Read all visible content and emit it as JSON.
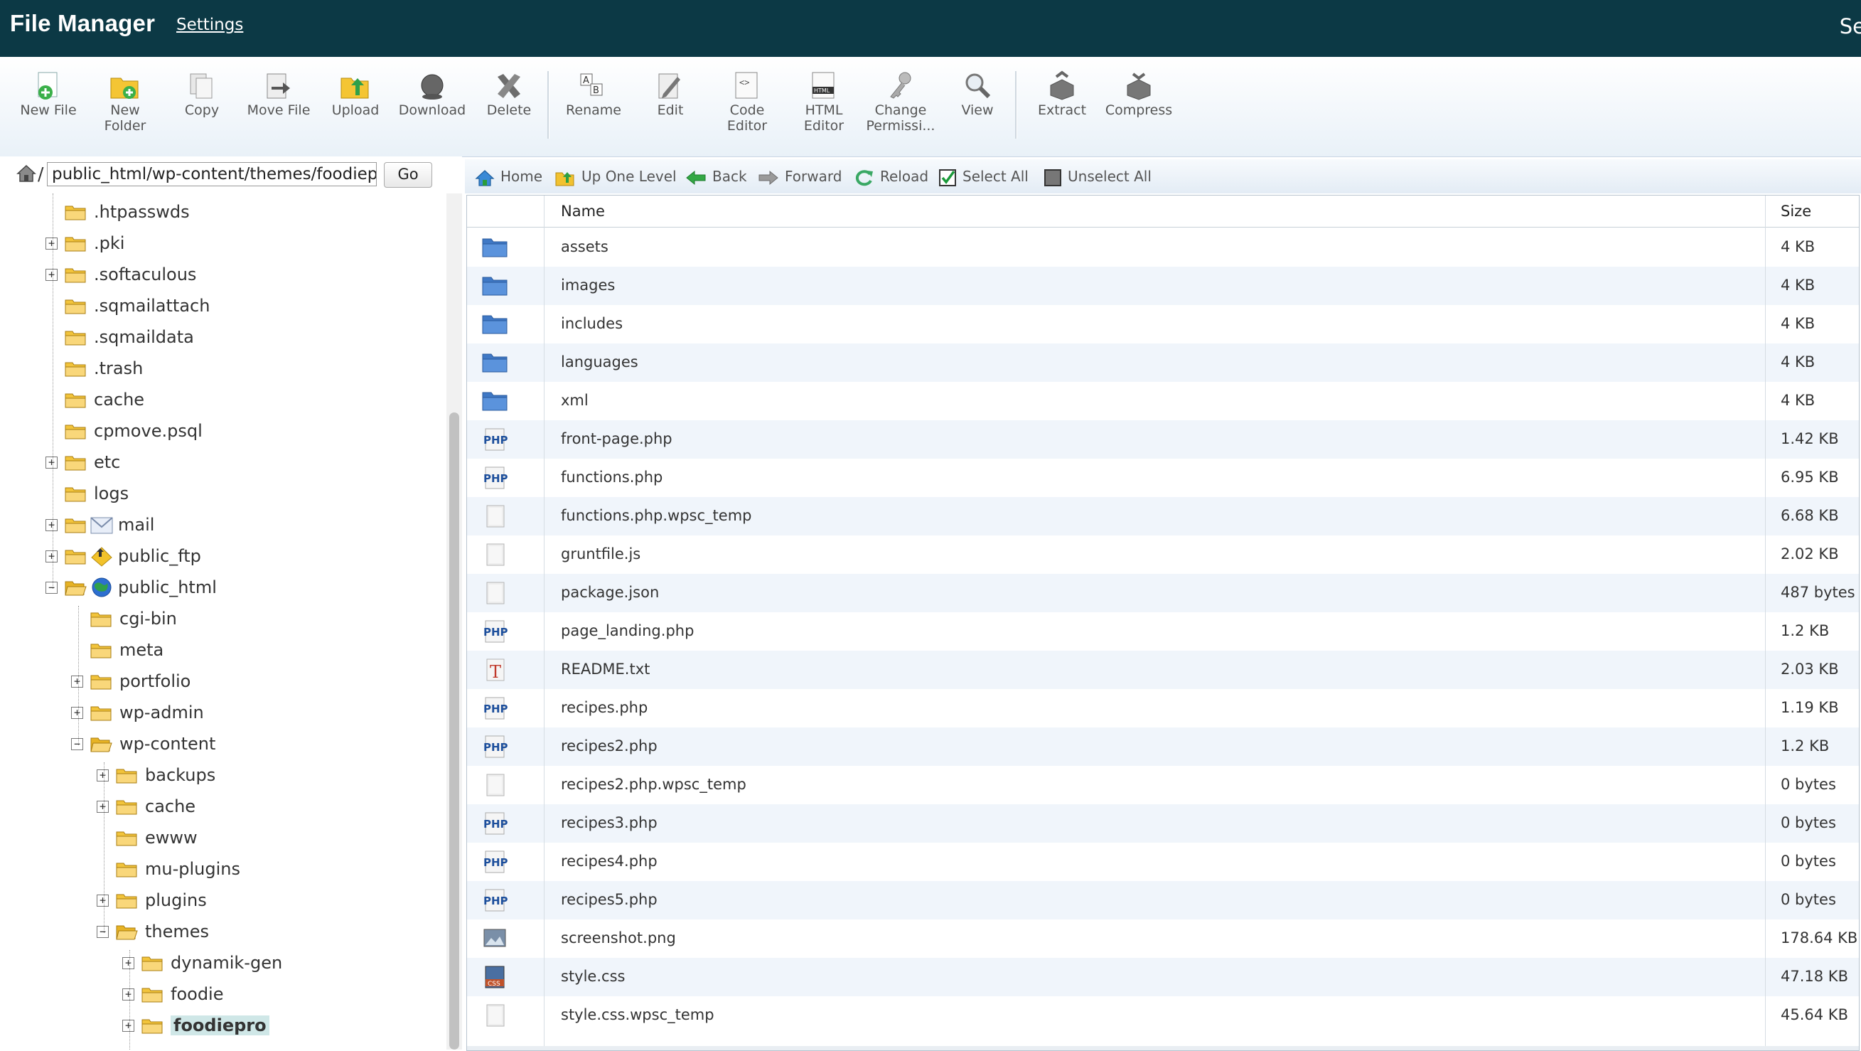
{
  "header": {
    "title": "File Manager",
    "settings": "Settings",
    "search_cut": "Se"
  },
  "toolbar": [
    {
      "label1": "New File",
      "label2": "",
      "icon": "new-file-icon"
    },
    {
      "label1": "New",
      "label2": "Folder",
      "icon": "new-folder-icon"
    },
    {
      "label1": "Copy",
      "label2": "",
      "icon": "copy-icon"
    },
    {
      "label1": "Move File",
      "label2": "",
      "icon": "move-file-icon"
    },
    {
      "label1": "Upload",
      "label2": "",
      "icon": "upload-icon"
    },
    {
      "label1": "Download",
      "label2": "",
      "icon": "download-icon"
    },
    {
      "label1": "Delete",
      "label2": "",
      "icon": "delete-icon"
    },
    {
      "label1": "Rename",
      "label2": "",
      "icon": "rename-icon"
    },
    {
      "label1": "Edit",
      "label2": "",
      "icon": "edit-icon"
    },
    {
      "label1": "Code",
      "label2": "Editor",
      "icon": "code-editor-icon"
    },
    {
      "label1": "HTML",
      "label2": "Editor",
      "icon": "html-editor-icon"
    },
    {
      "label1": "Change",
      "label2": "Permissi...",
      "icon": "change-permissions-icon"
    },
    {
      "label1": "View",
      "label2": "",
      "icon": "view-icon"
    },
    {
      "label1": "Extract",
      "label2": "",
      "icon": "extract-icon"
    },
    {
      "label1": "Compress",
      "label2": "",
      "icon": "compress-icon"
    }
  ],
  "path": {
    "slash": "/",
    "value": "public_html/wp-content/themes/foodiepro",
    "go": "Go"
  },
  "tree": [
    {
      "label": ".htpasswds",
      "expander": ""
    },
    {
      "label": ".pki",
      "expander": "+"
    },
    {
      "label": ".softaculous",
      "expander": "+"
    },
    {
      "label": ".sqmailattach",
      "expander": ""
    },
    {
      "label": ".sqmaildata",
      "expander": ""
    },
    {
      "label": ".trash",
      "expander": ""
    },
    {
      "label": "cache",
      "expander": ""
    },
    {
      "label": "cpmove.psql",
      "expander": ""
    },
    {
      "label": "etc",
      "expander": "+"
    },
    {
      "label": "logs",
      "expander": ""
    },
    {
      "label": "mail",
      "expander": "+"
    },
    {
      "label": "public_ftp",
      "expander": "+"
    },
    {
      "label": "public_html",
      "expander": "−"
    },
    {
      "label": "cgi-bin",
      "expander": ""
    },
    {
      "label": "meta",
      "expander": ""
    },
    {
      "label": "portfolio",
      "expander": "+"
    },
    {
      "label": "wp-admin",
      "expander": "+"
    },
    {
      "label": "wp-content",
      "expander": "−"
    },
    {
      "label": "backups",
      "expander": "+"
    },
    {
      "label": "cache",
      "expander": "+"
    },
    {
      "label": "ewww",
      "expander": ""
    },
    {
      "label": "mu-plugins",
      "expander": ""
    },
    {
      "label": "plugins",
      "expander": "+"
    },
    {
      "label": "themes",
      "expander": "−"
    },
    {
      "label": "dynamik-gen",
      "expander": "+"
    },
    {
      "label": "foodie",
      "expander": "+"
    },
    {
      "label": "foodiepro",
      "expander": "+",
      "selected": true
    }
  ],
  "nav": {
    "home": "Home",
    "up": "Up One Level",
    "back": "Back",
    "forward": "Forward",
    "reload": "Reload",
    "select_all": "Select All",
    "unselect_all": "Unselect All"
  },
  "table": {
    "col_name": "Name",
    "col_size": "Size",
    "rows": [
      {
        "name": "assets",
        "size": "4 KB",
        "type": "folder"
      },
      {
        "name": "images",
        "size": "4 KB",
        "type": "folder"
      },
      {
        "name": "includes",
        "size": "4 KB",
        "type": "folder"
      },
      {
        "name": "languages",
        "size": "4 KB",
        "type": "folder"
      },
      {
        "name": "xml",
        "size": "4 KB",
        "type": "folder"
      },
      {
        "name": "front-page.php",
        "size": "1.42 KB",
        "type": "php"
      },
      {
        "name": "functions.php",
        "size": "6.95 KB",
        "type": "php"
      },
      {
        "name": "functions.php.wpsc_temp",
        "size": "6.68 KB",
        "type": "file"
      },
      {
        "name": "gruntfile.js",
        "size": "2.02 KB",
        "type": "file"
      },
      {
        "name": "package.json",
        "size": "487 bytes",
        "type": "file"
      },
      {
        "name": "page_landing.php",
        "size": "1.2 KB",
        "type": "php"
      },
      {
        "name": "README.txt",
        "size": "2.03 KB",
        "type": "text"
      },
      {
        "name": "recipes.php",
        "size": "1.19 KB",
        "type": "php"
      },
      {
        "name": "recipes2.php",
        "size": "1.2 KB",
        "type": "php"
      },
      {
        "name": "recipes2.php.wpsc_temp",
        "size": "0 bytes",
        "type": "file"
      },
      {
        "name": "recipes3.php",
        "size": "0 bytes",
        "type": "php"
      },
      {
        "name": "recipes4.php",
        "size": "0 bytes",
        "type": "php"
      },
      {
        "name": "recipes5.php",
        "size": "0 bytes",
        "type": "php"
      },
      {
        "name": "screenshot.png",
        "size": "178.64 KB",
        "type": "image"
      },
      {
        "name": "style.css",
        "size": "47.18 KB",
        "type": "css"
      },
      {
        "name": "style.css.wpsc_temp",
        "size": "45.64 KB",
        "type": "file"
      }
    ]
  }
}
